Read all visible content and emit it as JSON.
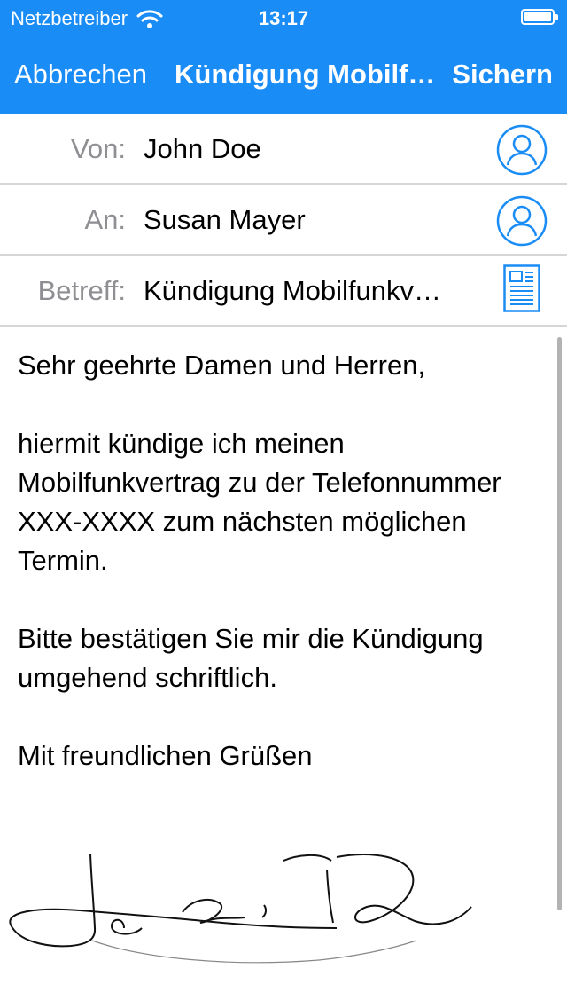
{
  "status_bar": {
    "carrier": "Netzbetreiber",
    "time": "13:17",
    "battery_level": 1.0
  },
  "nav": {
    "cancel_label": "Abbrechen",
    "title": "Kündigung Mobilfunkvertrag",
    "save_label": "Sichern"
  },
  "fields": {
    "from": {
      "label": "Von:",
      "value": "John Doe",
      "icon": "contact-icon"
    },
    "to": {
      "label": "An:",
      "value": "Susan Mayer",
      "icon": "contact-icon"
    },
    "subject": {
      "label": "Betreff:",
      "value": "Kündigung Mobilfunkvertrag",
      "icon": "document-icon"
    }
  },
  "letter": {
    "greeting": "Sehr geehrte Damen und Herren,",
    "paragraph1": "hiermit kündige ich meinen Mobilfunkvertrag zu der Telefonnummer XXX-XXXX zum nächsten möglichen Termin.",
    "paragraph2": "Bitte bestätigen Sie mir die Kündigung umgehend schriftlich.",
    "closing": "Mit freundlichen Grüßen"
  },
  "colors": {
    "accent": "#1a8cf6",
    "icon_blue": "#1a8cf6",
    "label_gray": "#8e8e93",
    "separator": "#d6d6d6"
  }
}
